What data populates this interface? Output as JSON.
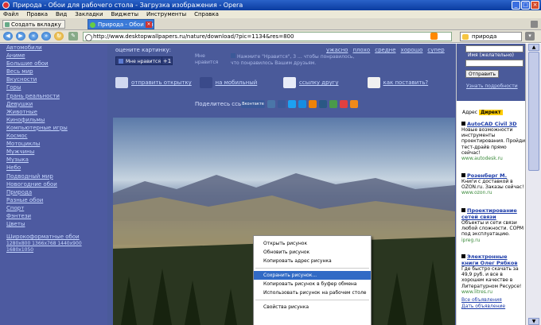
{
  "window": {
    "title": "Природа - Обои для рабочего стола - Загрузка изображения - Opera"
  },
  "menu": [
    "Файл",
    "Правка",
    "Вид",
    "Закладки",
    "Виджеты",
    "Инструменты",
    "Справка"
  ],
  "tabs": {
    "new_tab": "Создать вкладку",
    "active": "Природа - Обои для р..."
  },
  "address": {
    "url": "http://www.desktopwallpapers.ru/nature/download/?pic=1134&res=800",
    "search": "природа"
  },
  "sidebar": {
    "items": [
      "Автомобили",
      "Аниме",
      "Большие обои",
      "Весь мир",
      "Вкусности",
      "Горы",
      "Грань реальности",
      "Девушки",
      "Животные",
      "Кинофильмы",
      "Компьютерные игры",
      "Космос",
      "Мотоциклы",
      "Мужчины",
      "Музыка",
      "Небо",
      "Подводный мир",
      "Новогодние обои",
      "Природа",
      "Разные обои",
      "Спорт",
      "Фэнтези",
      "Цветы"
    ],
    "widescreen": "Широкоформатные обои",
    "resolutions": "1280x800 1366x768 1440x900 1680x1050"
  },
  "rating": {
    "prompt": "оцените картинку:",
    "like": "Мне нравится",
    "like_count": "+1",
    "dislike": "Мне нравится",
    "fb_text": "Нажмите \"Нравится\", 3 ... чтобы понравилось, что понравилось Вашим друзьям.",
    "scale": [
      "ужасно",
      "плохо",
      "средне",
      "хорошо",
      "супер"
    ]
  },
  "actions": [
    "отправить открытку",
    "на мобильный",
    "ссылку другу",
    "как поставить?"
  ],
  "share": {
    "label": "Поделитесь ссылкой",
    "vk": "Вконтакте"
  },
  "context_menu": {
    "group1": [
      "Открыть рисунок",
      "Обновить рисунок",
      "Копировать адрес рисунка"
    ],
    "group2": [
      "Сохранить рисунок...",
      "Копировать рисунок в буфер обмена",
      "Использовать рисунок на рабочем столе"
    ],
    "group3": [
      "Свойства рисунка"
    ]
  },
  "right": {
    "name_label": "Имя (желательно)",
    "send": "Отправить",
    "more": "Узнать подробности",
    "direct_label": "Адрес",
    "direct_logo": "Директ",
    "ads": [
      {
        "title": "AutoCAD Civil 3D",
        "text": "Новые возможности инструменты проектирования. Пройди тест-драйв прямо сейчас!",
        "url": "www.autodesk.ru"
      },
      {
        "title": "Розенберг М.",
        "text": "Книги с доставкой в OZON.ru. Заказы сейчас!",
        "url": "www.ozon.ru"
      },
      {
        "title": "Проектирование сетей связи",
        "text": "Объекты и сети связи любой сложности. СОРМ под эксплуатацию.",
        "url": "ipreg.ru"
      },
      {
        "title": "Электронные книги Олег Рябков",
        "text": "Где быстро скачать за 49,9 руб. и все в хорошем качестве в Литературном Ресурсе!",
        "url": "www.litres.ru"
      }
    ],
    "all_ads": "Все объявления",
    "give_ad": "Дать объявление"
  }
}
